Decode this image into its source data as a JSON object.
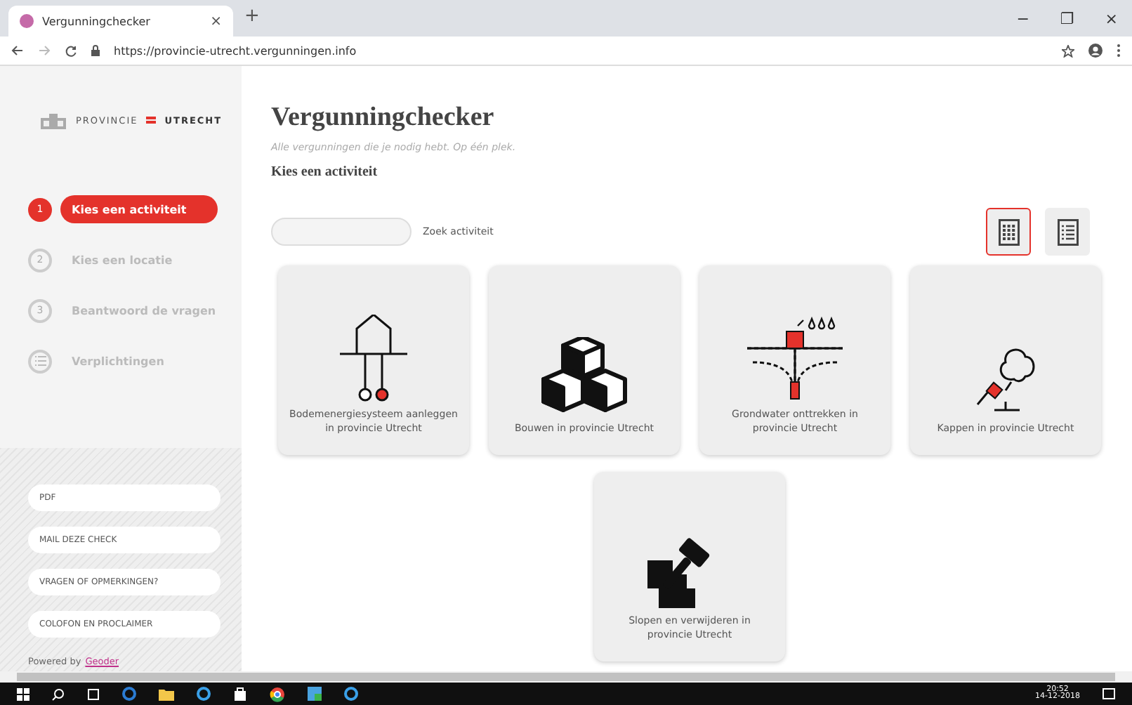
{
  "browser": {
    "tab_title": "Vergunningchecker",
    "tab_close": "×",
    "new_tab": "+",
    "url": "https://provincie-utrecht.vergunningen.info",
    "window_controls": [
      "−",
      "❐",
      "×"
    ]
  },
  "sidebar": {
    "logo_text_1": "PROVINCIE",
    "logo_text_2": "UTRECHT",
    "steps": [
      {
        "number": "1",
        "label": "Kies een activiteit",
        "selected": true,
        "kind": "number"
      },
      {
        "number": "2",
        "label": "Kies een locatie",
        "selected": false,
        "kind": "number"
      },
      {
        "number": "3",
        "label": "Beantwoord de vragen",
        "selected": false,
        "kind": "number"
      },
      {
        "label": "Verplichtingen",
        "selected": false,
        "kind": "list"
      }
    ],
    "links": [
      "PDF",
      "MAIL DEZE CHECK",
      "VRAGEN OF OPMERKINGEN?",
      "COLOFON EN PROCLAIMER"
    ],
    "powered_by": "Powered by",
    "powered_link": "Geoder"
  },
  "main": {
    "title": "Vergunningchecker",
    "subtitle": "Alle vergunningen die je nodig hebt. Op één plek.",
    "section": "Kies een activiteit",
    "search_label": "Zoek activiteit",
    "views": [
      {
        "kind": "grid",
        "selected": true
      },
      {
        "kind": "list",
        "selected": false
      }
    ],
    "cards": [
      {
        "kind": "ground",
        "label": "Bodemenergiesysteem aanleggen in provincie Utrecht"
      },
      {
        "kind": "blocks",
        "label": "Bouwen in provincie Utrecht"
      },
      {
        "kind": "water",
        "label": "Grondwater onttrekken in provincie Utrecht"
      },
      {
        "kind": "tree",
        "label": "Kappen in provincie Utrecht"
      },
      {
        "kind": "demolish",
        "label": "Slopen en verwijderen in provincie Utrecht"
      }
    ]
  },
  "taskbar": {
    "time": "20:52",
    "date": "14-12-2018"
  }
}
